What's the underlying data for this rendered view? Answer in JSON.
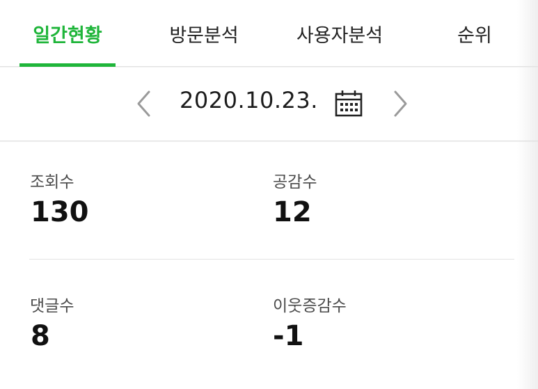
{
  "tabs": [
    {
      "label": "일간현황",
      "active": true
    },
    {
      "label": "방문분석",
      "active": false
    },
    {
      "label": "사용자분석",
      "active": false
    },
    {
      "label": "순위",
      "active": false
    }
  ],
  "date_nav": {
    "date": "2020.10.23.",
    "prev_icon": "chevron-left-icon",
    "next_icon": "chevron-right-icon",
    "calendar_icon": "calendar-icon"
  },
  "stats": [
    {
      "label": "조회수",
      "value": "130"
    },
    {
      "label": "공감수",
      "value": "12"
    },
    {
      "label": "댓글수",
      "value": "8"
    },
    {
      "label": "이웃증감수",
      "value": "-1"
    }
  ],
  "colors": {
    "accent": "#1fb53a",
    "text": "#1a1a1a",
    "muted": "#4a4a4a",
    "arrow": "#9a9a9a"
  }
}
